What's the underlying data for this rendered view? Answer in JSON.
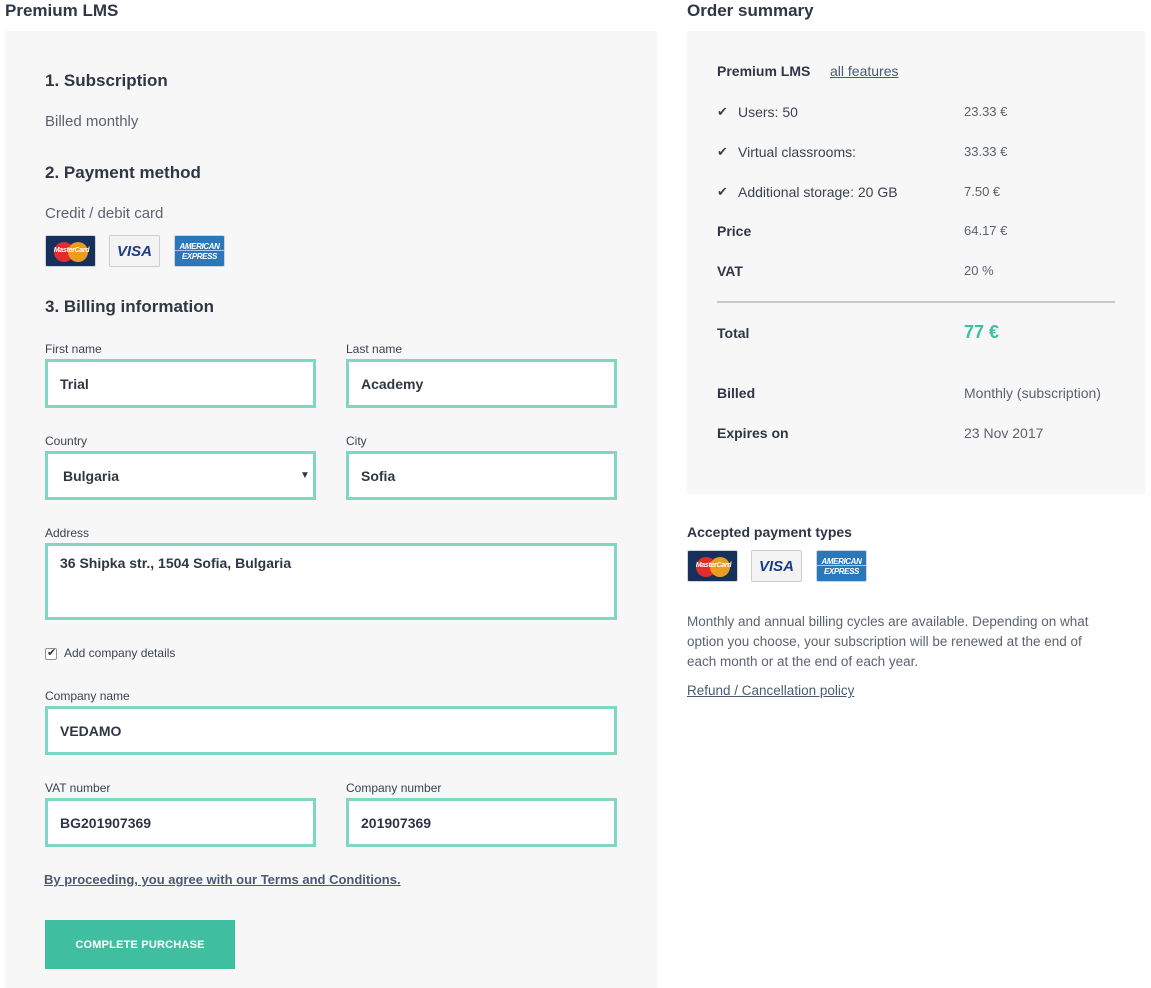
{
  "header": {
    "product_title": "Premium LMS",
    "summary_title": "Order summary"
  },
  "subscription": {
    "heading": "1. Subscription",
    "value": "Billed monthly"
  },
  "payment": {
    "heading": "2. Payment method",
    "value": "Credit / debit card",
    "cards": {
      "mastercard": "MasterCard",
      "visa": "VISA",
      "amex_line1": "AMERICAN",
      "amex_line2": "EXPRESS"
    }
  },
  "billing": {
    "heading": "3. Billing information",
    "first_name": {
      "label": "First name",
      "value": "Trial"
    },
    "last_name": {
      "label": "Last name",
      "value": "Academy"
    },
    "country": {
      "label": "Country",
      "value": "Bulgaria"
    },
    "city": {
      "label": "City",
      "value": "Sofia"
    },
    "address": {
      "label": "Address",
      "value": "36 Shipka str., 1504 Sofia, Bulgaria"
    },
    "company_checkbox": {
      "label": "Add company details",
      "checked": true
    },
    "company_name": {
      "label": "Company name",
      "value": "VEDAMO"
    },
    "vat_number": {
      "label": "VAT number",
      "value": "BG201907369"
    },
    "company_number": {
      "label": "Company number",
      "value": "201907369"
    },
    "terms_link": "By proceeding, you agree with our Terms and Conditions.",
    "complete_button": "Complete purchase"
  },
  "summary": {
    "plan_name": "Premium LMS",
    "all_features_link": "all features",
    "features": [
      {
        "label": "Users: 50",
        "value": "23.33 €"
      },
      {
        "label": "Virtual classrooms:",
        "value": "33.33 €"
      },
      {
        "label": "Additional storage: 20 GB",
        "value": "7.50 €"
      }
    ],
    "price": {
      "label": "Price",
      "value": "64.17 €"
    },
    "vat": {
      "label": "VAT",
      "value": "20 %"
    },
    "total": {
      "label": "Total",
      "value": "77 €"
    },
    "billed": {
      "label": "Billed",
      "value": "Monthly (subscription)"
    },
    "expires": {
      "label": "Expires on",
      "value": "23 Nov 2017"
    }
  },
  "accepted": {
    "title": "Accepted payment types",
    "note": "Monthly and annual billing cycles are available. Depending on what option you choose, your subscription will be renewed at the end of each month or at the end of each year.",
    "refund_link": "Refund / Cancellation policy"
  },
  "colors": {
    "accent": "#3fbfa0",
    "field_border": "#7fd6c1",
    "panel_bg": "#f7f7f7"
  },
  "icons": {
    "check": "check-icon",
    "select_arrow": "chevron-down-icon"
  }
}
